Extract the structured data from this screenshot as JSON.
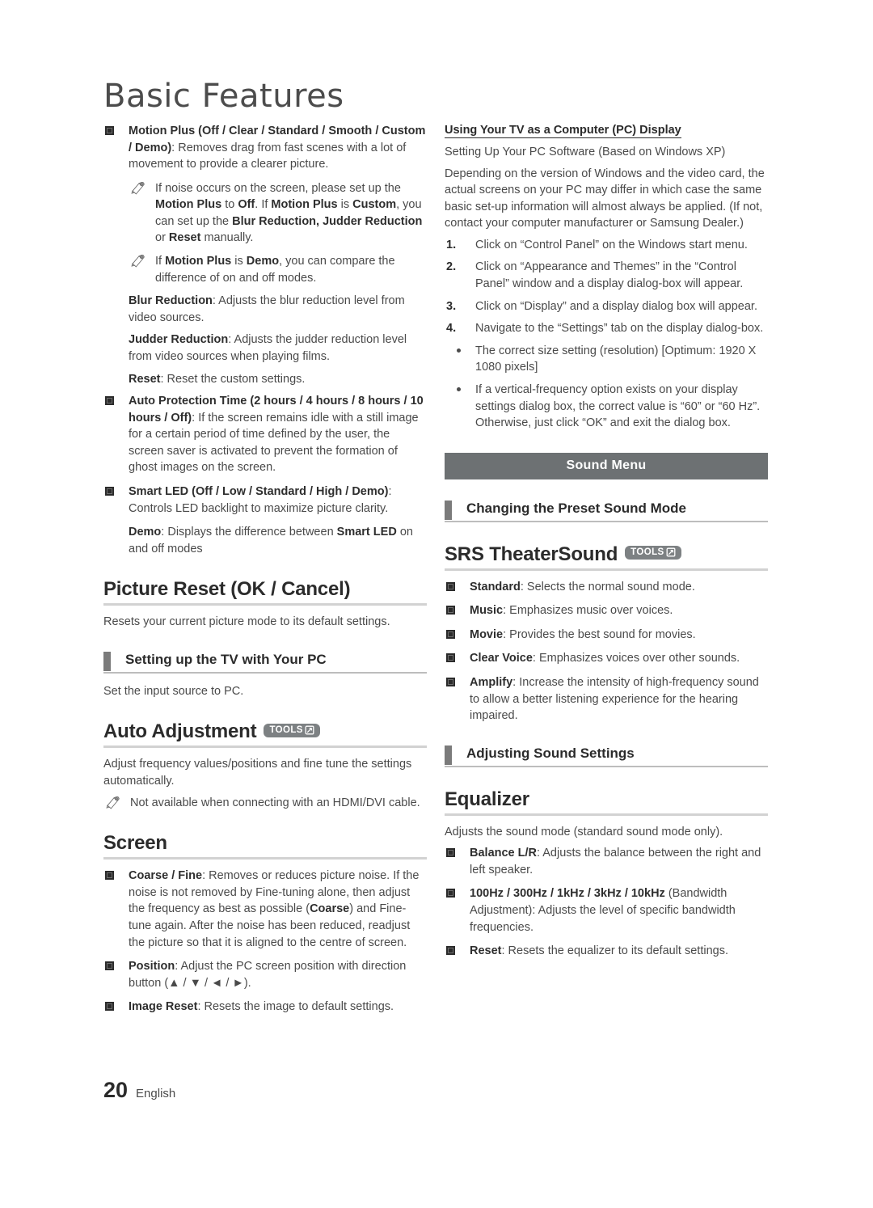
{
  "document": {
    "title": "Basic Features",
    "footer": {
      "page_number": "20",
      "language": "English"
    }
  },
  "left_column": {
    "motion_plus": {
      "label": "Motion Plus (Off / Clear / Standard / Smooth / Custom / Demo)",
      "text": ": Removes drag from fast scenes with a lot of movement to provide a clearer picture.",
      "note1_a": "If noise occurs on the screen, please set up the ",
      "note1_b": "Motion Plus",
      "note1_c": " to ",
      "note1_d": "Off",
      "note1_e": ". If ",
      "note1_f": "Motion Plus",
      "note1_g": " is ",
      "note1_h": "Custom",
      "note1_i": ", you can set up the ",
      "note1_j": "Blur Reduction, Judder Reduction",
      "note1_k": " or ",
      "note1_l": "Reset",
      "note1_m": " manually.",
      "note2_a": "If ",
      "note2_b": "Motion Plus",
      "note2_c": " is ",
      "note2_d": "Demo",
      "note2_e": ", you can compare the difference of on and off modes."
    },
    "blur_reduction": {
      "label": "Blur Reduction",
      "text": ": Adjusts the blur reduction level from video sources."
    },
    "judder_reduction": {
      "label": "Judder Reduction",
      "text": ": Adjusts the judder reduction level from video sources when playing films."
    },
    "reset": {
      "label": "Reset",
      "text": ": Reset the custom settings."
    },
    "auto_protection_time": {
      "label": "Auto Protection Time (2 hours / 4 hours / 8 hours / 10 hours / Off)",
      "text": ": If the screen remains idle with a still image for a certain period of time defined by the user, the screen saver is activated to prevent the formation of ghost images on the screen."
    },
    "smart_led": {
      "label": "Smart LED (Off / Low / Standard / High / Demo)",
      "text": ": Controls LED backlight to maximize picture clarity.",
      "demo_label": "Demo",
      "demo_text_a": ": Displays the difference between ",
      "demo_text_b": "Smart LED",
      "demo_text_c": " on and off modes"
    },
    "picture_reset": {
      "heading": "Picture Reset (OK / Cancel)",
      "body": "Resets your current picture mode to its default settings."
    },
    "setting_up_tv_pc": {
      "heading": "Setting up the TV with Your PC",
      "body": "Set the input source to PC."
    },
    "auto_adjustment": {
      "heading": "Auto Adjustment",
      "tools_badge": "TOOLS",
      "body": "Adjust frequency values/positions and fine tune the settings automatically.",
      "note": "Not available when connecting with an HDMI/DVI cable."
    },
    "screen": {
      "heading": "Screen",
      "coarse_fine_label": "Coarse / Fine",
      "coarse_fine_a": ": Removes or reduces picture noise. If the noise is not removed by Fine-tuning alone, then adjust the frequency as best as possible (",
      "coarse_fine_b": "Coarse",
      "coarse_fine_c": ") and Fine-tune again. After the noise has been reduced, readjust the picture so that it is aligned to the centre of screen.",
      "position_label": "Position",
      "position_text": ": Adjust the PC screen position with direction button (▲ / ▼ / ◄ / ►).",
      "image_reset_label": "Image Reset",
      "image_reset_text": ": Resets the image to default settings."
    }
  },
  "right_column": {
    "pc_display": {
      "heading": "Using Your TV as a Computer (PC) Display",
      "line1": "Setting Up Your PC Software (Based on Windows XP)",
      "line2": "Depending on the version of Windows and the video card, the actual screens on your PC may differ in which case the same basic set-up information will almost always be applied. (If not, contact your computer manufacturer or Samsung Dealer.)",
      "steps": [
        {
          "n": "1.",
          "text": "Click on “Control Panel” on the Windows start menu."
        },
        {
          "n": "2.",
          "text": "Click on “Appearance and Themes” in the “Control Panel” window and a display dialog-box will appear."
        },
        {
          "n": "3.",
          "text": "Click on “Display” and a display dialog box will appear."
        },
        {
          "n": "4.",
          "text": "Navigate to the “Settings” tab on the display dialog-box."
        }
      ],
      "dots": [
        "The correct size setting (resolution) [Optimum: 1920 X 1080 pixels]",
        "If a vertical-frequency option exists on your display settings dialog box, the correct value is “60” or “60 Hz”. Otherwise, just click “OK” and exit the dialog box."
      ]
    },
    "sound_menu_banner": "Sound Menu",
    "changing_preset_sound_mode": {
      "heading": "Changing the Preset Sound Mode"
    },
    "srs_theatersound": {
      "heading": "SRS TheaterSound",
      "tools_badge": "TOOLS",
      "items": [
        {
          "label": "Standard",
          "text": ": Selects the normal sound mode."
        },
        {
          "label": "Music",
          "text": ": Emphasizes music over voices."
        },
        {
          "label": "Movie",
          "text": ": Provides the best sound for movies."
        },
        {
          "label": "Clear Voice",
          "text": ": Emphasizes voices over other sounds."
        },
        {
          "label": "Amplify",
          "text": ": Increase the intensity of high-frequency sound to allow a better listening experience for the hearing impaired."
        }
      ]
    },
    "adjusting_sound_settings": {
      "heading": "Adjusting Sound Settings"
    },
    "equalizer": {
      "heading": "Equalizer",
      "body": "Adjusts the sound mode (standard sound mode only).",
      "items": [
        {
          "label": "Balance L/R",
          "text": ": Adjusts the balance between the right and left speaker."
        },
        {
          "label": "100Hz / 300Hz / 1kHz / 3kHz / 10kHz",
          "text": " (Bandwidth Adjustment): Adjusts the level of specific bandwidth frequencies."
        },
        {
          "label": "Reset",
          "text": ": Resets the equalizer to its default settings."
        }
      ]
    }
  },
  "colors": {
    "banner_bg": "#6d7173",
    "tools_bg": "#7d8183",
    "heading_bar": "#7b7b7b",
    "rule": "#d2d2d2",
    "text": "#4a4a4a"
  }
}
